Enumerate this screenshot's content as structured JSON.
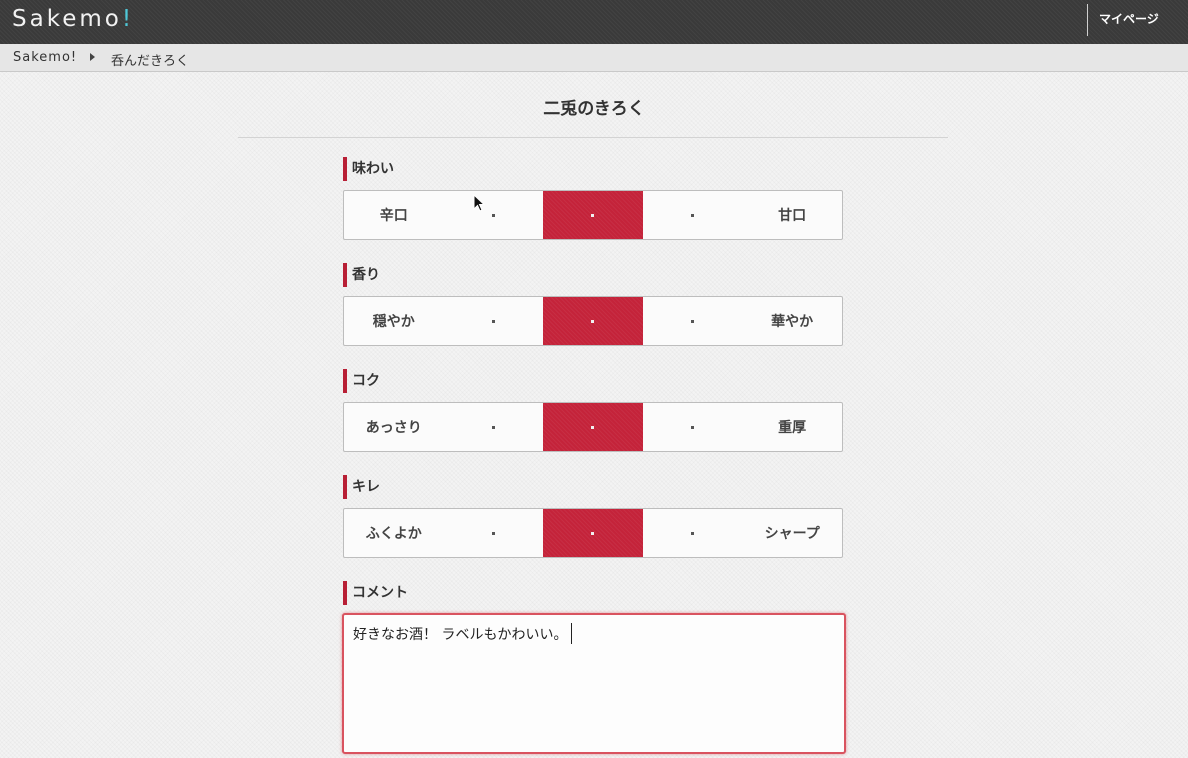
{
  "header": {
    "logo_text": "Sakemo",
    "logo_bang": "!",
    "mypage_label": "マイページ"
  },
  "breadcrumb": {
    "home": "Sakemo!",
    "current": "呑んだきろく"
  },
  "page": {
    "title": "二兎のきろく"
  },
  "ratings": [
    {
      "label": "味わい",
      "left": "辛口",
      "right": "甘口",
      "selected_index": 2
    },
    {
      "label": "香り",
      "left": "穏やか",
      "right": "華やか",
      "selected_index": 2
    },
    {
      "label": "コク",
      "left": "あっさり",
      "right": "重厚",
      "selected_index": 2
    },
    {
      "label": "キレ",
      "left": "ふくよか",
      "right": "シャープ",
      "selected_index": 2
    }
  ],
  "comment": {
    "label": "コメント",
    "value": "好きなお酒！ ラベルもかわいい。"
  },
  "colors": {
    "accent": "#c4233a",
    "header_bg": "#3a3a3a",
    "logo_bang": "#4fc8d8"
  }
}
